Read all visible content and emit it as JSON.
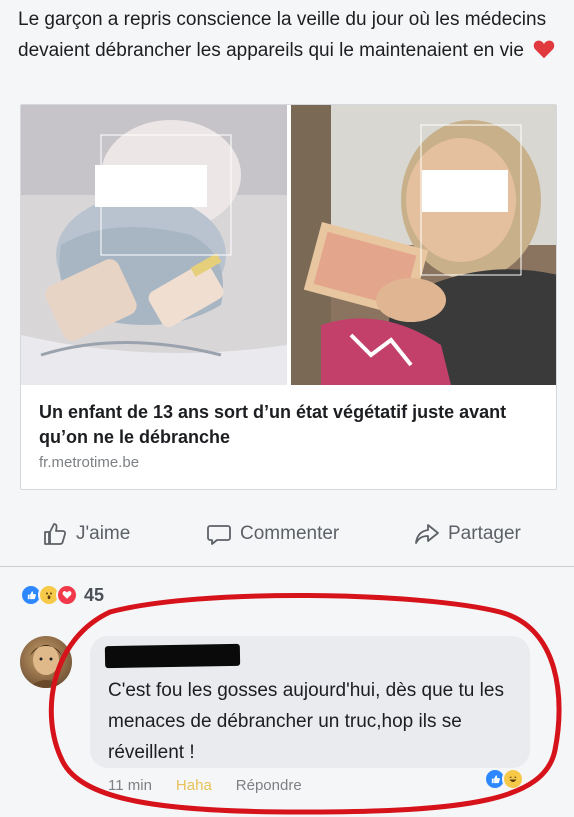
{
  "post": {
    "text": "Le garçon a repris conscience la veille du jour où les médecins devaient débrancher les appareils qui le maintenaient en vie",
    "emoji": "heart-icon"
  },
  "link": {
    "title": "Un enfant de 13 ans sort d’un état végétatif juste avant qu’on ne le débranche",
    "domain": "fr.metrotime.be"
  },
  "actions": {
    "like": "J'aime",
    "comment": "Commenter",
    "share": "Partager"
  },
  "reactions": {
    "icons": [
      "like-icon",
      "wow-icon",
      "heart-icon"
    ],
    "count": "45"
  },
  "comment": {
    "text": "C'est fou les gosses aujourd'hui, dès que tu les menaces de débrancher un truc,hop ils se réveillent !",
    "time": "11 min",
    "haha": "Haha",
    "reply": "Répondre",
    "reactions": [
      "like-icon",
      "haha-icon"
    ]
  },
  "colors": {
    "facebook_blue": "#3b5998",
    "like_blue": "#2d88ff",
    "heart_red": "#e0393e",
    "annotation_red": "#d6131b",
    "haha_yellow": "#e8c15a"
  }
}
